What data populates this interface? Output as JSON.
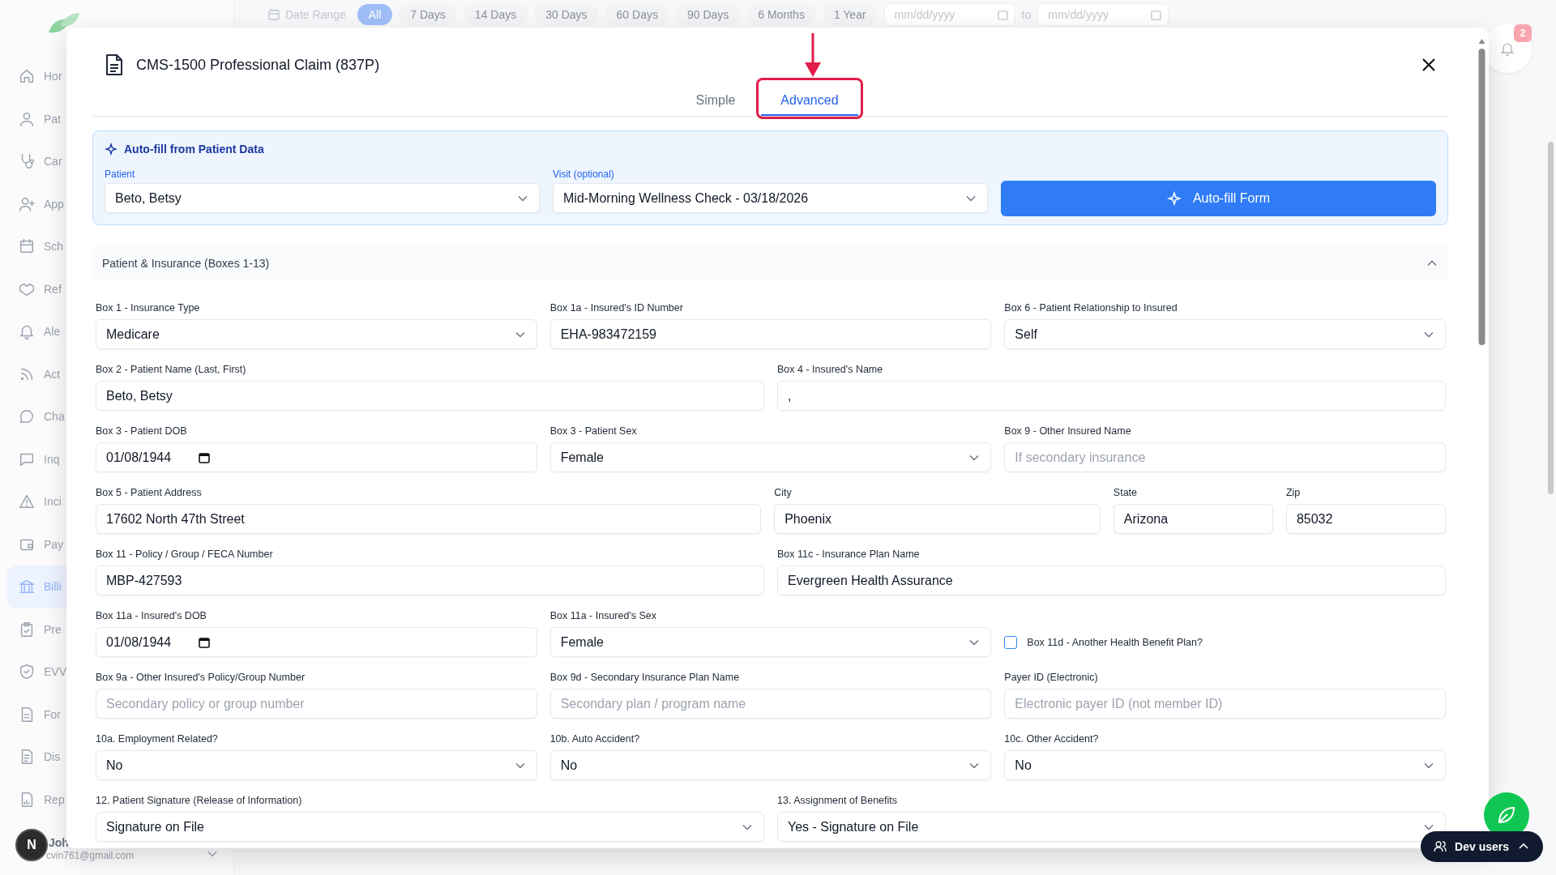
{
  "sidebar": {
    "items": [
      {
        "label": "Hor",
        "selected": false
      },
      {
        "label": "Pat",
        "selected": false
      },
      {
        "label": "Car",
        "selected": false
      },
      {
        "label": "App",
        "selected": false
      },
      {
        "label": "Sch",
        "selected": false
      },
      {
        "label": "Ref",
        "selected": false
      },
      {
        "label": "Ale",
        "selected": false
      },
      {
        "label": "Act",
        "selected": false
      },
      {
        "label": "Cha",
        "selected": false
      },
      {
        "label": "Inq",
        "selected": false
      },
      {
        "label": "Inci",
        "selected": false
      },
      {
        "label": "Pay",
        "selected": false
      },
      {
        "label": "Billi",
        "selected": true
      },
      {
        "label": "Pre",
        "selected": false
      },
      {
        "label": "EVV",
        "selected": false
      },
      {
        "label": "For",
        "selected": false
      },
      {
        "label": "Dis",
        "selected": false
      },
      {
        "label": "Rep",
        "selected": false
      }
    ],
    "user": {
      "avatar": "N",
      "name": "Joh",
      "email": "cvin761@gmail.com"
    }
  },
  "topbar": {
    "date_range_label": "Date Range",
    "chips": [
      {
        "label": "All",
        "selected": true
      },
      {
        "label": "7 Days",
        "selected": false
      },
      {
        "label": "14 Days",
        "selected": false
      },
      {
        "label": "30 Days",
        "selected": false
      },
      {
        "label": "60 Days",
        "selected": false
      },
      {
        "label": "90 Days",
        "selected": false
      },
      {
        "label": "6 Months",
        "selected": false
      },
      {
        "label": "1 Year",
        "selected": false
      }
    ],
    "date_from": {
      "placeholder": "mm/dd/yyyy"
    },
    "separator": "to",
    "date_to": {
      "placeholder": "mm/dd/yyyy"
    }
  },
  "notifications": {
    "badge": "2"
  },
  "dev_button": {
    "label": "Dev users"
  },
  "modal": {
    "title": "CMS-1500 Professional Claim (837P)",
    "tabs": [
      {
        "label": "Simple",
        "selected": false,
        "highlighted": false
      },
      {
        "label": "Advanced",
        "selected": true,
        "highlighted": true
      }
    ],
    "autofill": {
      "title": "Auto-fill from Patient Data",
      "patient": {
        "label": "Patient",
        "value": "Beto, Betsy"
      },
      "visit": {
        "label": "Visit (optional)",
        "value": "Mid-Morning Wellness Check - 03/18/2026"
      },
      "button": "Auto-fill Form"
    },
    "section": {
      "title": "Patient & Insurance (Boxes 1-13)",
      "expanded": true,
      "rows": [
        [
          {
            "kind": "select",
            "label": "Box 1 - Insurance Type",
            "value": "Medicare"
          },
          {
            "kind": "input",
            "label": "Box 1a - Insured's ID Number",
            "value": "EHA-983472159"
          },
          {
            "kind": "select",
            "label": "Box 6 - Patient Relationship to Insured",
            "value": "Self"
          }
        ],
        [
          {
            "kind": "input",
            "label": "Box 2 - Patient Name (Last, First)",
            "value": "Beto, Betsy"
          },
          {
            "kind": "input",
            "label": "Box 4 - Insured's Name",
            "value": ","
          }
        ],
        [
          {
            "kind": "date",
            "label": "Box 3 - Patient DOB",
            "value": "01/08/1944"
          },
          {
            "kind": "select",
            "label": "Box 3 - Patient Sex",
            "value": "Female"
          },
          {
            "kind": "input",
            "label": "Box 9 - Other Insured Name",
            "placeholder": "If secondary insurance"
          }
        ],
        [
          {
            "kind": "input",
            "label": "Box 5 - Patient Address",
            "value": "17602 North 47th Street"
          },
          {
            "kind": "input",
            "label": "City",
            "value": "Phoenix"
          },
          {
            "kind": "input",
            "label": "State",
            "value": "Arizona"
          },
          {
            "kind": "input",
            "label": "Zip",
            "value": "85032"
          }
        ],
        [
          {
            "kind": "input",
            "label": "Box 11 - Policy / Group / FECA Number",
            "value": "MBP-427593"
          },
          {
            "kind": "input",
            "label": "Box 11c - Insurance Plan Name",
            "value": "Evergreen Health Assurance"
          }
        ],
        [
          {
            "kind": "date",
            "label": "Box 11a - Insured's DOB",
            "value": "01/08/1944"
          },
          {
            "kind": "select",
            "label": "Box 11a - Insured's Sex",
            "value": "Female"
          },
          {
            "kind": "checkbox",
            "label": "Box 11d - Another Health Benefit Plan?",
            "checked": false
          }
        ],
        [
          {
            "kind": "input",
            "label": "Box 9a - Other Insured's Policy/Group Number",
            "placeholder": "Secondary policy or group number"
          },
          {
            "kind": "input",
            "label": "Box 9d - Secondary Insurance Plan Name",
            "placeholder": "Secondary plan / program name"
          },
          {
            "kind": "input",
            "label": "Payer ID (Electronic)",
            "placeholder": "Electronic payer ID (not member ID)"
          }
        ],
        [
          {
            "kind": "select",
            "label": "10a. Employment Related?",
            "value": "No"
          },
          {
            "kind": "select",
            "label": "10b. Auto Accident?",
            "value": "No"
          },
          {
            "kind": "select",
            "label": "10c. Other Accident?",
            "value": "No"
          }
        ],
        [
          {
            "kind": "select",
            "label": "12. Patient Signature (Release of Information)",
            "value": "Signature on File"
          },
          {
            "kind": "select",
            "label": "13. Assignment of Benefits",
            "value": "Yes - Signature on File"
          }
        ]
      ]
    }
  }
}
